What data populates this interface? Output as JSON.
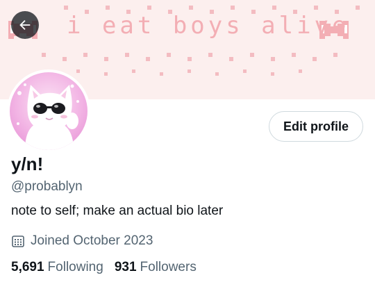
{
  "banner": {
    "text": "i eat boys alive",
    "colors": {
      "background": "#fcefee",
      "pixel": "#f3aeb4"
    }
  },
  "back_button": {
    "icon": "arrow-left-icon"
  },
  "avatar": {
    "icon": "cat-with-sunglasses"
  },
  "edit_profile": {
    "label": "Edit profile"
  },
  "profile": {
    "display_name": "y/n!",
    "handle": "@probablyn",
    "bio": "note to self; make an actual bio later",
    "joined": "Joined October 2023",
    "joined_icon": "calendar-icon"
  },
  "stats": {
    "following": {
      "count": "5,691",
      "label": "Following"
    },
    "followers": {
      "count": "931",
      "label": "Followers"
    }
  },
  "colors": {
    "text_primary": "#0f1419",
    "text_secondary": "#536471",
    "border": "#cfd9de"
  }
}
